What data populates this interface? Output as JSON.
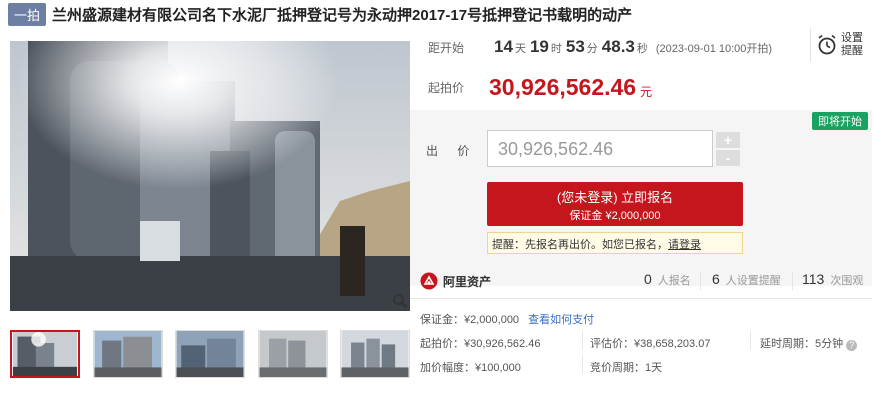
{
  "header": {
    "tag": "一拍",
    "title": "兰州盛源建材有限公司名下水泥厂抵押登记号为永动押2017-17号抵押登记书载明的动产"
  },
  "countdown": {
    "label": "距开始",
    "days": "14",
    "days_unit": "天",
    "hours": "19",
    "hours_unit": "时",
    "minutes": "53",
    "minutes_unit": "分",
    "seconds": "48.3",
    "seconds_unit": "秒",
    "start_at": "(2023-09-01 10:00开拍)"
  },
  "alarm": {
    "line1": "设置",
    "line2": "提醒",
    "icon": "alarm-clock-icon"
  },
  "start_price": {
    "label": "起拍价",
    "value": "30,926,562.46",
    "unit": "元"
  },
  "bid": {
    "badge": "即将开始",
    "label": "出 价",
    "input_value": "30,926,562.46",
    "plus": "+",
    "minus": "-",
    "button_main": "(您未登录) 立即报名",
    "button_sub": "保证金 ¥2,000,000",
    "tip_text": "提醒：先报名再出价。如您已报名，",
    "tip_link": "请登录"
  },
  "stats": {
    "brand": "阿里资产",
    "signups": "0",
    "signups_label": "人报名",
    "reminders": "6",
    "reminders_label": "人设置提醒",
    "views": "113",
    "views_label": "次围观"
  },
  "info": {
    "deposit": "保证金：¥2,000,000",
    "deposit_link": "查看如何支付",
    "start_price": "起拍价：¥30,926,562.46",
    "appraisal": "评估价：¥38,658,203.07",
    "delay": "延时周期：5分钟",
    "increment": "加价幅度：¥100,000",
    "cycle": "竞价周期：1天"
  },
  "colors": {
    "brand_red": "#c4161c",
    "badge_green": "#1aa260",
    "tag_blue": "#6d7fa3"
  }
}
